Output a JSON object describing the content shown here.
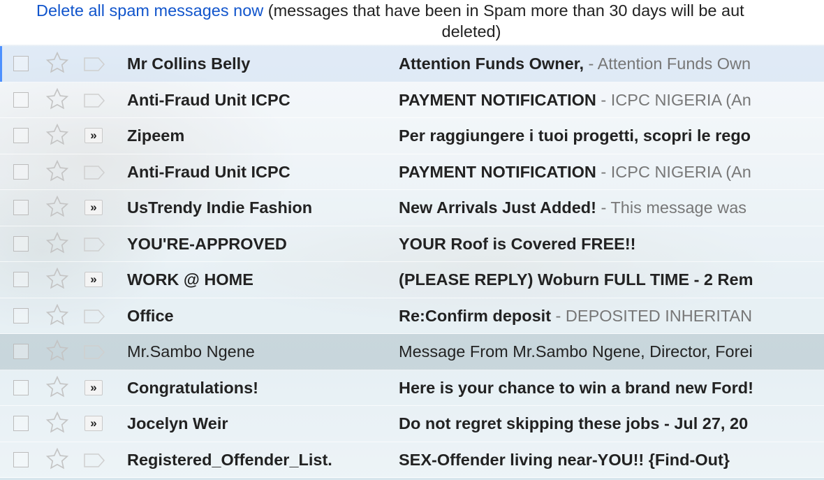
{
  "notice": {
    "link": "Delete all spam messages now",
    "text_line1": "(messages that have been in Spam more than 30 days will be aut",
    "text_line2": "deleted)"
  },
  "emails": [
    {
      "sender": "Mr Collins Belly",
      "subject": "Attention Funds Owner,",
      "snippet": "Attention Funds Own",
      "important": false,
      "read": false
    },
    {
      "sender": "Anti-Fraud Unit ICPC",
      "subject": "PAYMENT NOTIFICATION",
      "snippet": "ICPC NIGERIA (An",
      "important": false,
      "read": false
    },
    {
      "sender": "Zipeem",
      "subject": "Per raggiungere i tuoi progetti, scopri le rego",
      "snippet": "",
      "important": true,
      "read": false
    },
    {
      "sender": "Anti-Fraud Unit ICPC",
      "subject": "PAYMENT NOTIFICATION",
      "snippet": "ICPC NIGERIA (An",
      "important": false,
      "read": false
    },
    {
      "sender": "UsTrendy Indie Fashion",
      "subject": "New Arrivals Just Added!",
      "snippet": "This message was",
      "important": true,
      "read": false
    },
    {
      "sender": "YOU'RE-APPROVED",
      "subject": "YOUR Roof is Covered FREE!!",
      "snippet": "",
      "important": false,
      "read": false
    },
    {
      "sender": "WORK @ HOME",
      "subject": "(PLEASE REPLY) Woburn FULL TIME - 2 Rem",
      "snippet": "",
      "important": true,
      "read": false
    },
    {
      "sender": "Office",
      "subject": "Re:Confirm deposit",
      "snippet": "DEPOSITED INHERITAN",
      "important": false,
      "read": false
    },
    {
      "sender": "Mr.Sambo Ngene",
      "subject": "Message From Mr.Sambo Ngene, Director, Forei",
      "snippet": "",
      "important": false,
      "read": true
    },
    {
      "sender": "Congratulations!",
      "subject": "Here is your chance to win a brand new Ford!",
      "snippet": "",
      "important": true,
      "read": false
    },
    {
      "sender": "Jocelyn Weir",
      "subject": "Do not regret skipping these jobs - Jul 27, 20",
      "snippet": "",
      "important": true,
      "read": false
    },
    {
      "sender": "Registered_Offender_List.",
      "subject": "SEX-Offender living near-YOU!! {Find-Out}",
      "snippet": "",
      "important": false,
      "read": false
    }
  ],
  "important_marker": "»",
  "snippet_separator": " - "
}
